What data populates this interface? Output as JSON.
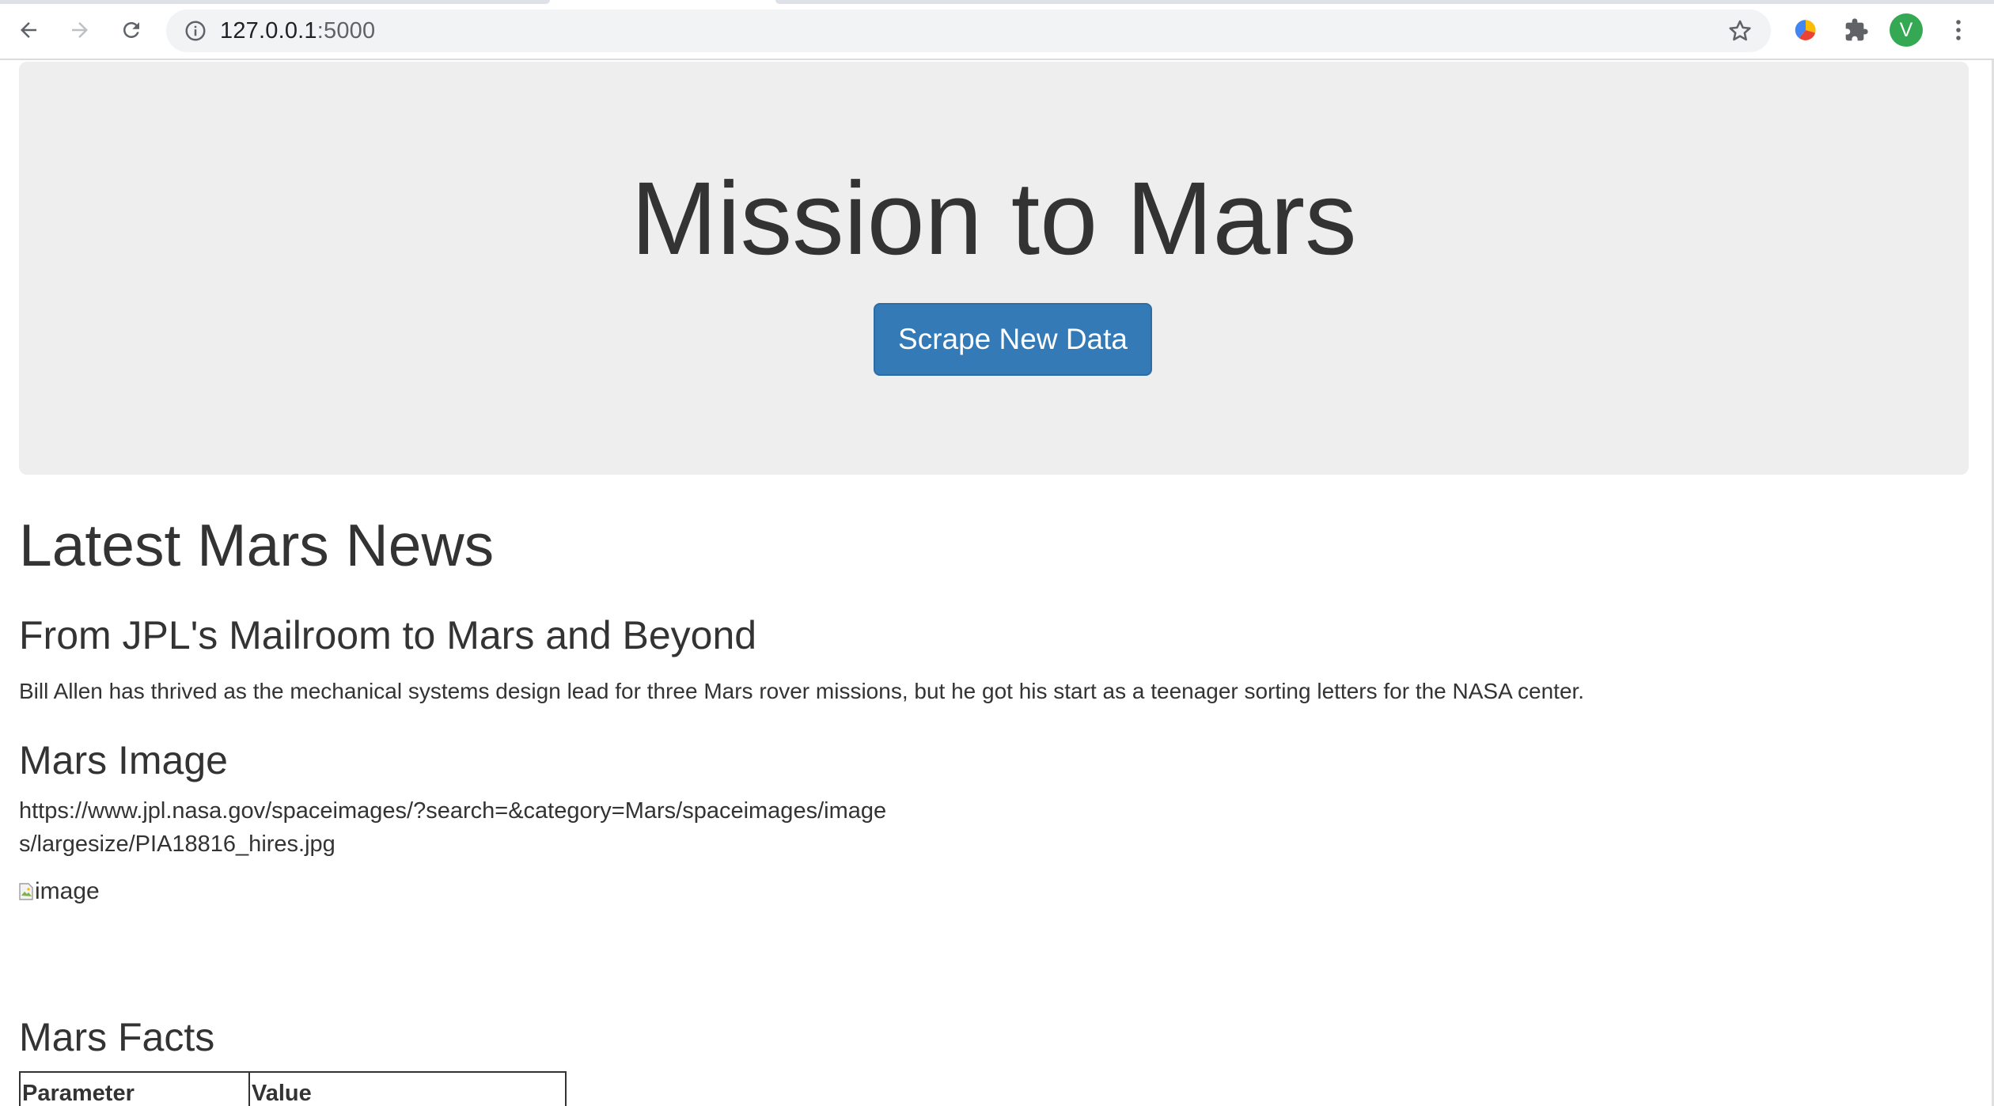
{
  "browser": {
    "url_host": "127.0.0.1",
    "url_port": ":5000",
    "avatar_letter": "V",
    "icons": [
      "back-arrow-icon",
      "forward-arrow-icon",
      "reload-icon",
      "info-icon",
      "star-icon",
      "color-wheel-extension-icon",
      "puzzle-piece-icon",
      "kebab-menu-icon"
    ]
  },
  "jumbotron": {
    "title": "Mission to Mars",
    "button_label": "Scrape New Data",
    "button_color": "#337ab7"
  },
  "news": {
    "section_title": "Latest Mars News",
    "article_title": "From JPL's Mailroom to Mars and Beyond",
    "article_paragraph": "Bill Allen has thrived as the mechanical systems design lead for three Mars rover missions, but he got his start as a teenager sorting letters for the NASA center."
  },
  "image_section": {
    "section_title": "Mars Image",
    "image_url": "https://www.jpl.nasa.gov/spaceimages/?search=&category=Mars/spaceimages/images/largesize/PIA18816_hires.jpg",
    "image_alt": "image"
  },
  "facts": {
    "section_title": "Mars Facts",
    "columns": [
      "Parameter",
      "Value"
    ]
  }
}
